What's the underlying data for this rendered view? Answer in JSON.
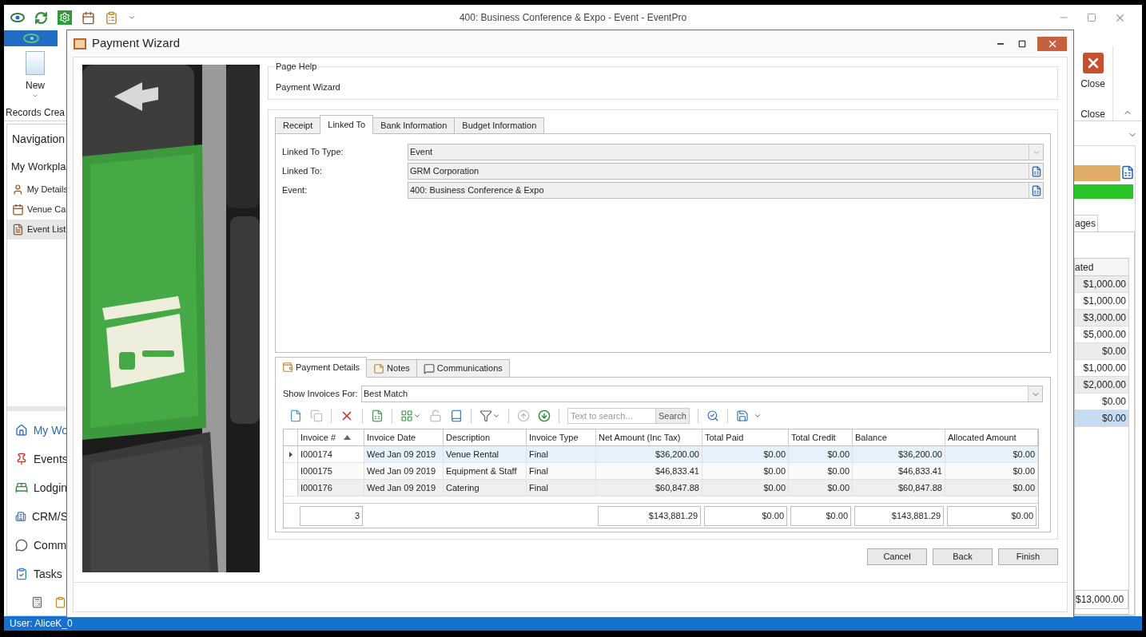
{
  "window": {
    "title": "400: Business Conference & Expo - Event - EventPro"
  },
  "ribbon": {
    "new_button": "New",
    "records_group": "Records Crea",
    "close_button": "Close",
    "close_group": "Close"
  },
  "navigation": {
    "title": "Navigation",
    "section": "My Workpla",
    "items": [
      {
        "label": "My Details",
        "selected": false
      },
      {
        "label": "Venue Ca",
        "selected": false
      },
      {
        "label": "Event List",
        "selected": true
      }
    ],
    "modules": [
      {
        "label": "My Wo",
        "selected": true
      },
      {
        "label": "Events",
        "selected": false
      },
      {
        "label": "Lodgin",
        "selected": false
      },
      {
        "label": "CRM/S",
        "selected": false
      },
      {
        "label": "Comm",
        "selected": false
      },
      {
        "label": "Tasks",
        "selected": false
      }
    ]
  },
  "right_panel": {
    "tab": "ages",
    "column": "ated",
    "rows": [
      {
        "value": "$1,000.00",
        "selected": false
      },
      {
        "value": "$1,000.00",
        "selected": false
      },
      {
        "value": "$3,000.00",
        "selected": false
      },
      {
        "value": "$5,000.00",
        "selected": false
      },
      {
        "value": "$0.00",
        "selected": false
      },
      {
        "value": "$1,000.00",
        "selected": false
      },
      {
        "value": "$2,000.00",
        "selected": false
      },
      {
        "value": "$0.00",
        "selected": false
      },
      {
        "value": "$0.00",
        "selected": true
      }
    ],
    "total": "$13,000.00"
  },
  "status_bar": {
    "user": "User: AliceK_0"
  },
  "dialog": {
    "title": "Payment Wizard",
    "page_help": {
      "legend": "Page Help",
      "text": "Payment Wizard"
    },
    "tabs": [
      {
        "label": "Receipt",
        "selected": false
      },
      {
        "label": "Linked To",
        "selected": true
      },
      {
        "label": "Bank Information",
        "selected": false
      },
      {
        "label": "Budget Information",
        "selected": false
      }
    ],
    "fields": [
      {
        "label": "Linked To Type:",
        "value": "Event",
        "kind": "dropdown"
      },
      {
        "label": "Linked To:",
        "value": "GRM Corporation",
        "kind": "lookup"
      },
      {
        "label": "Event:",
        "value": "400: Business Conference & Expo",
        "kind": "lookup"
      }
    ],
    "detail_tabs": [
      {
        "label": "Payment Details",
        "selected": true
      },
      {
        "label": "Notes",
        "selected": false
      },
      {
        "label": "Communications",
        "selected": false
      }
    ],
    "show_invoices_for": {
      "label": "Show Invoices For:",
      "value": "Best Match"
    },
    "toolbar": [
      {
        "kind": "new",
        "disabled": false
      },
      {
        "kind": "copy",
        "disabled": true
      },
      {
        "kind": "separator"
      },
      {
        "kind": "delete",
        "disabled": false
      },
      {
        "kind": "separator"
      },
      {
        "kind": "export",
        "disabled": false
      },
      {
        "kind": "separator"
      },
      {
        "kind": "columns",
        "disabled": false
      },
      {
        "kind": "unlock",
        "disabled": true
      },
      {
        "kind": "book",
        "disabled": false
      },
      {
        "kind": "separator"
      },
      {
        "kind": "filter",
        "disabled": false
      },
      {
        "kind": "separator"
      },
      {
        "kind": "up",
        "disabled": true
      },
      {
        "kind": "down",
        "disabled": false
      },
      {
        "kind": "separator"
      },
      {
        "kind": "search"
      },
      {
        "kind": "separator"
      },
      {
        "kind": "find",
        "disabled": false
      },
      {
        "kind": "separator"
      },
      {
        "kind": "save",
        "disabled": false
      }
    ],
    "search": {
      "placeholder": "Text to search...",
      "button": "Search"
    },
    "table": {
      "columns": [
        {
          "label": "Invoice #",
          "sorted": true,
          "kind": "text"
        },
        {
          "label": "Invoice Date",
          "sorted": false,
          "kind": "text"
        },
        {
          "label": "Description",
          "sorted": false,
          "kind": "text"
        },
        {
          "label": "Invoice Type",
          "sorted": false,
          "kind": "text"
        },
        {
          "label": "Net Amount (Inc Tax)",
          "sorted": false,
          "kind": "amount"
        },
        {
          "label": "Total Paid",
          "sorted": false,
          "kind": "amount"
        },
        {
          "label": "Total Credit",
          "sorted": false,
          "kind": "amount"
        },
        {
          "label": "Balance",
          "sorted": false,
          "kind": "amount"
        },
        {
          "label": "Allocated Amount",
          "sorted": false,
          "kind": "amount"
        }
      ],
      "rows": [
        {
          "selected": true,
          "cells": [
            "I000174",
            "Wed Jan 09 2019",
            "Venue Rental",
            "Final",
            "$36,200.00",
            "$0.00",
            "$0.00",
            "$36,200.00",
            "$0.00"
          ]
        },
        {
          "selected": false,
          "cells": [
            "I000175",
            "Wed Jan 09 2019",
            "Equipment & Staff",
            "Final",
            "$46,833.41",
            "$0.00",
            "$0.00",
            "$46,833.41",
            "$0.00"
          ]
        },
        {
          "selected": false,
          "cells": [
            "I000176",
            "Wed Jan 09 2019",
            "Catering",
            "Final",
            "$60,847.88",
            "$0.00",
            "$0.00",
            "$60,847.88",
            "$0.00"
          ]
        }
      ],
      "footer": [
        {
          "kind": "sum",
          "value": "3"
        },
        {
          "kind": "blank"
        },
        {
          "kind": "blank"
        },
        {
          "kind": "blank"
        },
        {
          "kind": "sum",
          "value": "$143,881.29"
        },
        {
          "kind": "sum",
          "value": "$0.00"
        },
        {
          "kind": "sum",
          "value": "$0.00"
        },
        {
          "kind": "sum",
          "value": "$143,881.29"
        },
        {
          "kind": "sum",
          "value": "$0.00"
        }
      ]
    },
    "buttons": [
      "Cancel",
      "Back",
      "Finish"
    ]
  }
}
